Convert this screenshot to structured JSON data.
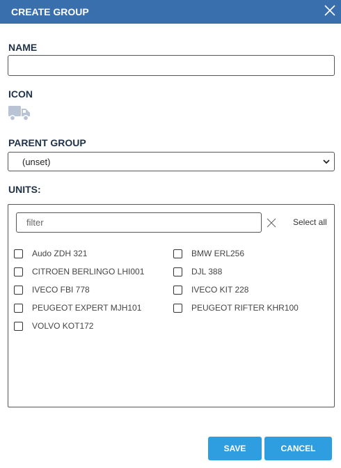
{
  "dialog": {
    "title": "CREATE GROUP"
  },
  "name": {
    "label": "NAME",
    "value": "",
    "placeholder": ""
  },
  "icon": {
    "label": "ICON",
    "selected": "truck-icon"
  },
  "parent_group": {
    "label": "PARENT GROUP",
    "value": "(unset)"
  },
  "units": {
    "label": "UNITS:",
    "filter_placeholder": "filter",
    "select_all": "Select all",
    "items": [
      {
        "label": "Audo ZDH 321",
        "checked": false
      },
      {
        "label": "BMW ERL256",
        "checked": false
      },
      {
        "label": "CITROEN BERLINGO LHI001",
        "checked": false
      },
      {
        "label": "DJL 388",
        "checked": false
      },
      {
        "label": "IVECO FBI 778",
        "checked": false
      },
      {
        "label": "IVECO KIT 228",
        "checked": false
      },
      {
        "label": "PEUGEOT EXPERT MJH101",
        "checked": false
      },
      {
        "label": "PEUGEOT RIFTER KHR100",
        "checked": false
      },
      {
        "label": "VOLVO KOT172",
        "checked": false
      }
    ]
  },
  "buttons": {
    "save": "SAVE",
    "cancel": "CANCEL"
  },
  "colors": {
    "header": "#3a6fae",
    "primary_button": "#2f9ee0",
    "icon": "#b8c4d4"
  }
}
